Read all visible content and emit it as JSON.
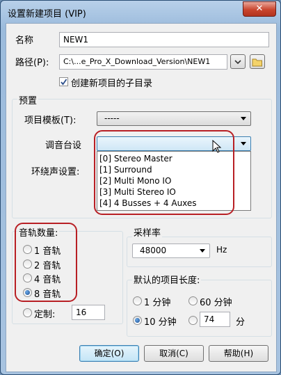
{
  "window": {
    "title": "设置新建项目 (VIP)",
    "close_glyph": "✕"
  },
  "name_label": "名称",
  "name_value": "NEW1",
  "path_label": "路径(P):",
  "path_value": "C:\\...e_Pro_X_Download_Version\\NEW1",
  "subdir_checkbox_label": "创建新项目的子目录",
  "subdir_checked": true,
  "preset_group_title": "预置",
  "template_label": "项目模板(T):",
  "template_value": "-----",
  "mixer_label": "调音台设",
  "mixer_value": "",
  "surround_label": "环绕声设置:",
  "mixer_options": [
    "[0] Stereo Master",
    "[1] Surround",
    "[2] Multi Mono IO",
    "[3] Multi Stereo IO",
    "[4] 4 Busses + 4 Auxes"
  ],
  "tracks_group_title": "音轨数量:",
  "track_options": [
    "1 音轨",
    "2 音轨",
    "4 音轨",
    "8 音轨"
  ],
  "track_selected": "8 音轨",
  "custom_label": "定制:",
  "custom_value": "16",
  "samplerate_group_title": "采样率",
  "samplerate_value": "48000",
  "samplerate_unit": "Hz",
  "length_group_title": "默认的项目长度:",
  "length_options": [
    "1 分钟",
    "60 分钟",
    "10 分钟"
  ],
  "length_selected": "10 分钟",
  "length_custom_value": "74",
  "length_custom_unit": "分",
  "buttons": {
    "ok": "确定(O)",
    "cancel": "取消(C)",
    "help": "帮助(H)"
  },
  "accent_colors": {
    "highlight_ring": "#b81f24",
    "default_button": "#3c7fb1"
  }
}
